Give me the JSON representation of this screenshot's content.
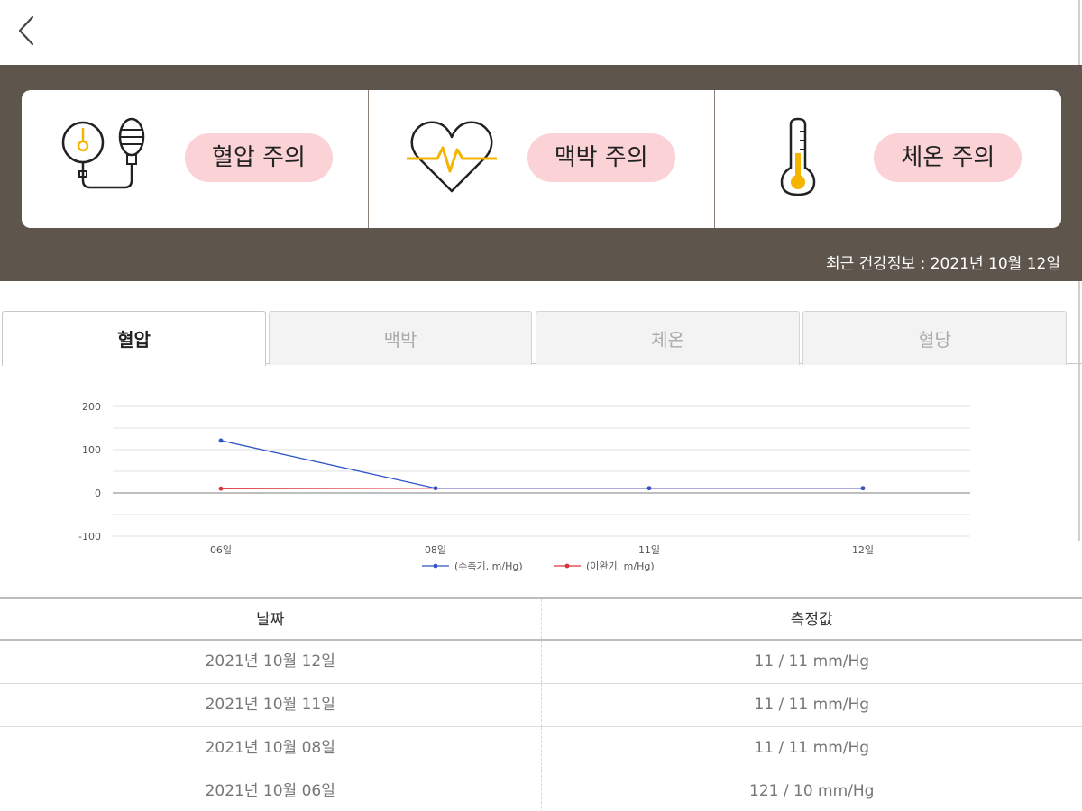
{
  "status": {
    "items": [
      {
        "label": "혈압 주의",
        "icon": "blood-pressure-icon"
      },
      {
        "label": "맥박 주의",
        "icon": "heart-pulse-icon"
      },
      {
        "label": "체온 주의",
        "icon": "thermometer-icon"
      }
    ],
    "recent_info": "최근 건강정보 : 2021년 10월 12일",
    "pill_color": "#fbd3d6",
    "band_color": "#5e564d",
    "accent_color": "#f4b400"
  },
  "tabs": [
    {
      "label": "혈압",
      "active": true
    },
    {
      "label": "맥박",
      "active": false
    },
    {
      "label": "체온",
      "active": false
    },
    {
      "label": "혈당",
      "active": false
    }
  ],
  "chart_data": {
    "type": "line",
    "categories": [
      "06일",
      "08일",
      "11일",
      "12일"
    ],
    "series": [
      {
        "name": "(수축기, m/Hg)",
        "values": [
          121,
          11,
          11,
          11
        ],
        "color": "#2f55c8"
      },
      {
        "name": "(이완기, m/Hg)",
        "values": [
          10,
          11,
          11,
          11
        ],
        "color": "#d9343c"
      }
    ],
    "yticks": [
      200,
      100,
      0,
      -100
    ],
    "ylim": [
      -100,
      200
    ],
    "grid": true,
    "legend": "bottom"
  },
  "table": {
    "headers": [
      "날짜",
      "측정값"
    ],
    "rows": [
      [
        "2021년 10월 12일",
        "11 / 11 mm/Hg"
      ],
      [
        "2021년 10월 11일",
        "11 / 11 mm/Hg"
      ],
      [
        "2021년 10월 08일",
        "11 / 11 mm/Hg"
      ],
      [
        "2021년 10월 06일",
        "121 / 10 mm/Hg"
      ]
    ]
  }
}
